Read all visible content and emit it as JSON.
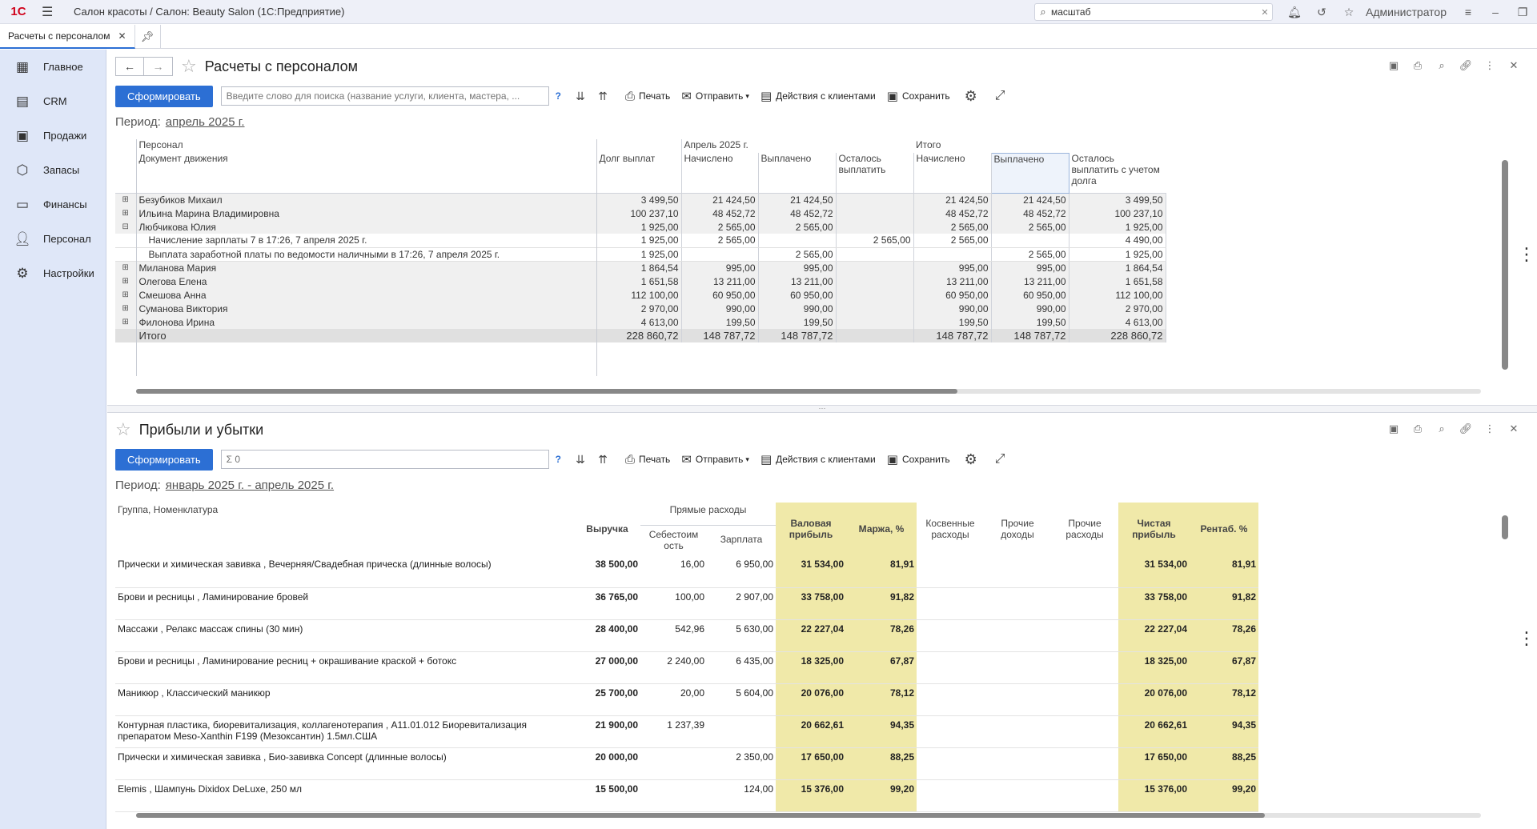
{
  "app": {
    "logo": "1С",
    "title": "Салон красоты / Салон: Beauty Salon  (1С:Предприятие)",
    "search_value": "масштаб",
    "user": "Администратор"
  },
  "tabs": [
    {
      "label": "Расчеты с персоналом"
    }
  ],
  "sidebar": {
    "items": [
      {
        "label": "Главное"
      },
      {
        "label": "CRM"
      },
      {
        "label": "Продажи"
      },
      {
        "label": "Запасы"
      },
      {
        "label": "Финансы"
      },
      {
        "label": "Персонал"
      },
      {
        "label": "Настройки"
      }
    ]
  },
  "report1": {
    "title": "Расчеты с персоналом",
    "generate_label": "Сформировать",
    "search_placeholder": "Введите слово для поиска (название услуги, клиента, мастера, ...",
    "help": "?",
    "print_label": "Печать",
    "send_label": "Отправить",
    "client_actions_label": "Действия с клиентами",
    "save_label": "Сохранить",
    "period_label": "Период:",
    "period_value": "апрель 2025 г.",
    "header": {
      "col_personnel": "Персонал",
      "col_document": "Документ движения",
      "col_debt": "Долг выплат",
      "group_april": "Апрель 2025 г.",
      "group_total": "Итого",
      "accrued": "Начислено",
      "paid": "Выплачено",
      "remaining": "Осталось выплатить",
      "remaining_with_debt": "Осталось выплатить с учетом долга"
    },
    "rows": [
      {
        "kind": "grp",
        "toggle": "⊞",
        "name": "Безубиков Михаил",
        "debt": "3 499,50",
        "acc": "21 424,50",
        "paid": "21 424,50",
        "rem": "",
        "tacc": "21 424,50",
        "tpaid": "21 424,50",
        "trem": "3 499,50"
      },
      {
        "kind": "grp",
        "toggle": "⊞",
        "name": "Ильина Марина Владимировна",
        "debt": "100 237,10",
        "acc": "48 452,72",
        "paid": "48 452,72",
        "rem": "",
        "tacc": "48 452,72",
        "tpaid": "48 452,72",
        "trem": "100 237,10"
      },
      {
        "kind": "grp",
        "toggle": "⊟",
        "name": "Любчикова Юлия",
        "debt": "1 925,00",
        "acc": "2 565,00",
        "paid": "2 565,00",
        "rem": "",
        "tacc": "2 565,00",
        "tpaid": "2 565,00",
        "trem": "1 925,00"
      },
      {
        "kind": "sub",
        "toggle": "",
        "name": "Начисление зарплаты 7 в 17:26, 7 апреля 2025 г.",
        "debt": "1 925,00",
        "acc": "2 565,00",
        "paid": "",
        "rem": "2 565,00",
        "tacc": "2 565,00",
        "tpaid": "",
        "trem": "4 490,00"
      },
      {
        "kind": "sub",
        "toggle": "",
        "name": "Выплата заработной платы по ведомости наличными в 17:26, 7 апреля 2025 г.",
        "debt": "1 925,00",
        "acc": "",
        "paid": "2 565,00",
        "rem": "",
        "tacc": "",
        "tpaid": "2 565,00",
        "trem": "1 925,00"
      },
      {
        "kind": "grp",
        "toggle": "⊞",
        "name": "Миланова Мария",
        "debt": "1 864,54",
        "acc": "995,00",
        "paid": "995,00",
        "rem": "",
        "tacc": "995,00",
        "tpaid": "995,00",
        "trem": "1 864,54"
      },
      {
        "kind": "grp",
        "toggle": "⊞",
        "name": "Олегова Елена",
        "debt": "1 651,58",
        "acc": "13 211,00",
        "paid": "13 211,00",
        "rem": "",
        "tacc": "13 211,00",
        "tpaid": "13 211,00",
        "trem": "1 651,58"
      },
      {
        "kind": "grp",
        "toggle": "⊞",
        "name": "Смешова Анна",
        "debt": "112 100,00",
        "acc": "60 950,00",
        "paid": "60 950,00",
        "rem": "",
        "tacc": "60 950,00",
        "tpaid": "60 950,00",
        "trem": "112 100,00"
      },
      {
        "kind": "grp",
        "toggle": "⊞",
        "name": "Суманова Виктория",
        "debt": "2 970,00",
        "acc": "990,00",
        "paid": "990,00",
        "rem": "",
        "tacc": "990,00",
        "tpaid": "990,00",
        "trem": "2 970,00"
      },
      {
        "kind": "grp",
        "toggle": "⊞",
        "name": "Филонова Ирина",
        "debt": "4 613,00",
        "acc": "199,50",
        "paid": "199,50",
        "rem": "",
        "tacc": "199,50",
        "tpaid": "199,50",
        "trem": "4 613,00"
      },
      {
        "kind": "tot",
        "toggle": "",
        "name": "Итого",
        "debt": "228 860,72",
        "acc": "148 787,72",
        "paid": "148 787,72",
        "rem": "",
        "tacc": "148 787,72",
        "tpaid": "148 787,72",
        "trem": "228 860,72"
      }
    ]
  },
  "report2": {
    "title": "Прибыли и убытки",
    "generate_label": "Сформировать",
    "search_placeholder": "Σ 0",
    "help": "?",
    "print_label": "Печать",
    "send_label": "Отправить",
    "client_actions_label": "Действия с клиентами",
    "save_label": "Сохранить",
    "period_label": "Период:",
    "period_value": "январь 2025 г. - апрель 2025 г.",
    "header": {
      "group": "Группа, Номенклатура",
      "revenue": "Выручка",
      "direct_costs": "Прямые расходы",
      "cost_price": "Себестоим ость",
      "salary": "Зарплата",
      "gross_profit": "Валовая прибыль",
      "margin": "Маржа, %",
      "indirect": "Косвенные расходы",
      "other_income": "Прочие доходы",
      "other_expenses": "Прочие расходы",
      "net_profit": "Чистая прибыль",
      "profitability": "Рентаб. %"
    },
    "rows": [
      {
        "name": "Прически и химическая завивка  , Вечерняя/Свадебная прическа (длинные волосы)",
        "rev": "38 500,00",
        "cost": "16,00",
        "sal": "6 950,00",
        "gp": "31 534,00",
        "mar": "81,91",
        "np": "31 534,00",
        "rent": "81,91"
      },
      {
        "name": "Брови и ресницы , Ламинирование бровей",
        "rev": "36 765,00",
        "cost": "100,00",
        "sal": "2 907,00",
        "gp": "33 758,00",
        "mar": "91,82",
        "np": "33 758,00",
        "rent": "91,82"
      },
      {
        "name": "Массажи , Релакс массаж спины (30 мин)",
        "rev": "28 400,00",
        "cost": "542,96",
        "sal": "5 630,00",
        "gp": "22 227,04",
        "mar": "78,26",
        "np": "22 227,04",
        "rent": "78,26"
      },
      {
        "name": "Брови и ресницы , Ламинирование ресниц + окрашивание краской + ботокс",
        "rev": "27 000,00",
        "cost": "2 240,00",
        "sal": "6 435,00",
        "gp": "18 325,00",
        "mar": "67,87",
        "np": "18 325,00",
        "rent": "67,87"
      },
      {
        "name": "Маникюр , Классический маникюр",
        "rev": "25 700,00",
        "cost": "20,00",
        "sal": "5 604,00",
        "gp": "20 076,00",
        "mar": "78,12",
        "np": "20 076,00",
        "rent": "78,12"
      },
      {
        "name": "Контурная пластика, биоревитализация, коллагенотерапия  , A11.01.012 Биоревитализация препаратом Meso-Xanthin F199 (Мезоксантин) 1.5мл.США",
        "rev": "21 900,00",
        "cost": "1 237,39",
        "sal": "",
        "gp": "20 662,61",
        "mar": "94,35",
        "np": "20 662,61",
        "rent": "94,35"
      },
      {
        "name": "Прически и химическая завивка  , Био-завивка Concept (длинные волосы)",
        "rev": "20 000,00",
        "cost": "",
        "sal": "2 350,00",
        "gp": "17 650,00",
        "mar": "88,25",
        "np": "17 650,00",
        "rent": "88,25"
      },
      {
        "name": "Elemis , Шампунь Dixidox DeLuxe, 250 мл",
        "rev": "15 500,00",
        "cost": "",
        "sal": "124,00",
        "gp": "15 376,00",
        "mar": "99,20",
        "np": "15 376,00",
        "rent": "99,20"
      }
    ]
  },
  "icons": {
    "sidebar": [
      "calendar-icon",
      "crm-card-icon",
      "cart-icon",
      "box-icon",
      "card-icon",
      "person-icon",
      "gear-icon"
    ]
  },
  "colors": {
    "primary": "#2c6fd4",
    "highlight": "#f0e9a9",
    "sidebar": "#dfe7f8"
  }
}
